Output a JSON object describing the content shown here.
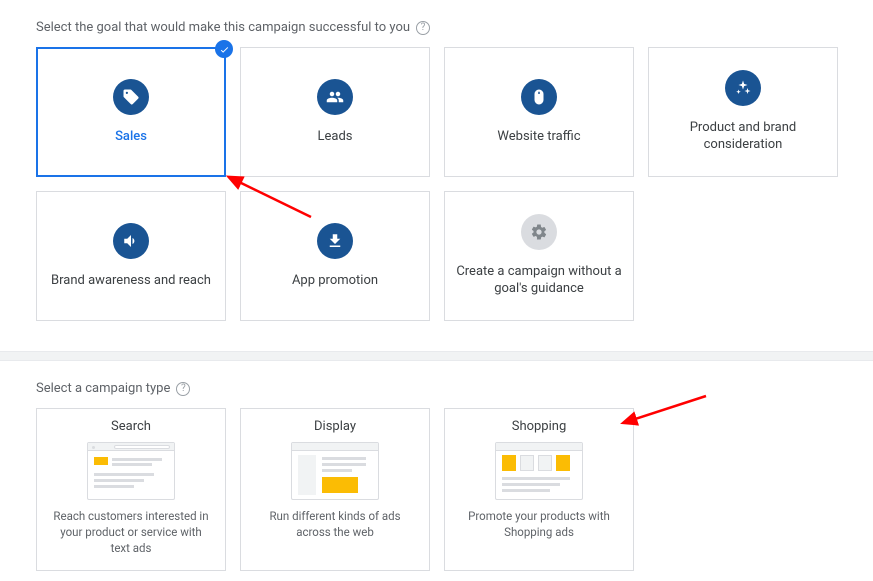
{
  "goals": {
    "header": "Select the goal that would make this campaign successful to you",
    "items": [
      {
        "label": "Sales",
        "selected": true
      },
      {
        "label": "Leads"
      },
      {
        "label": "Website traffic"
      },
      {
        "label": "Product and brand consideration"
      },
      {
        "label": "Brand awareness and reach"
      },
      {
        "label": "App promotion"
      },
      {
        "label": "Create a campaign without a goal's guidance",
        "muted": true
      }
    ]
  },
  "types": {
    "header": "Select a campaign type",
    "items": [
      {
        "title": "Search",
        "desc": "Reach customers interested in your product or service with text ads"
      },
      {
        "title": "Display",
        "desc": "Run different kinds of ads across the web"
      },
      {
        "title": "Shopping",
        "desc": "Promote your products with Shopping ads"
      }
    ]
  }
}
